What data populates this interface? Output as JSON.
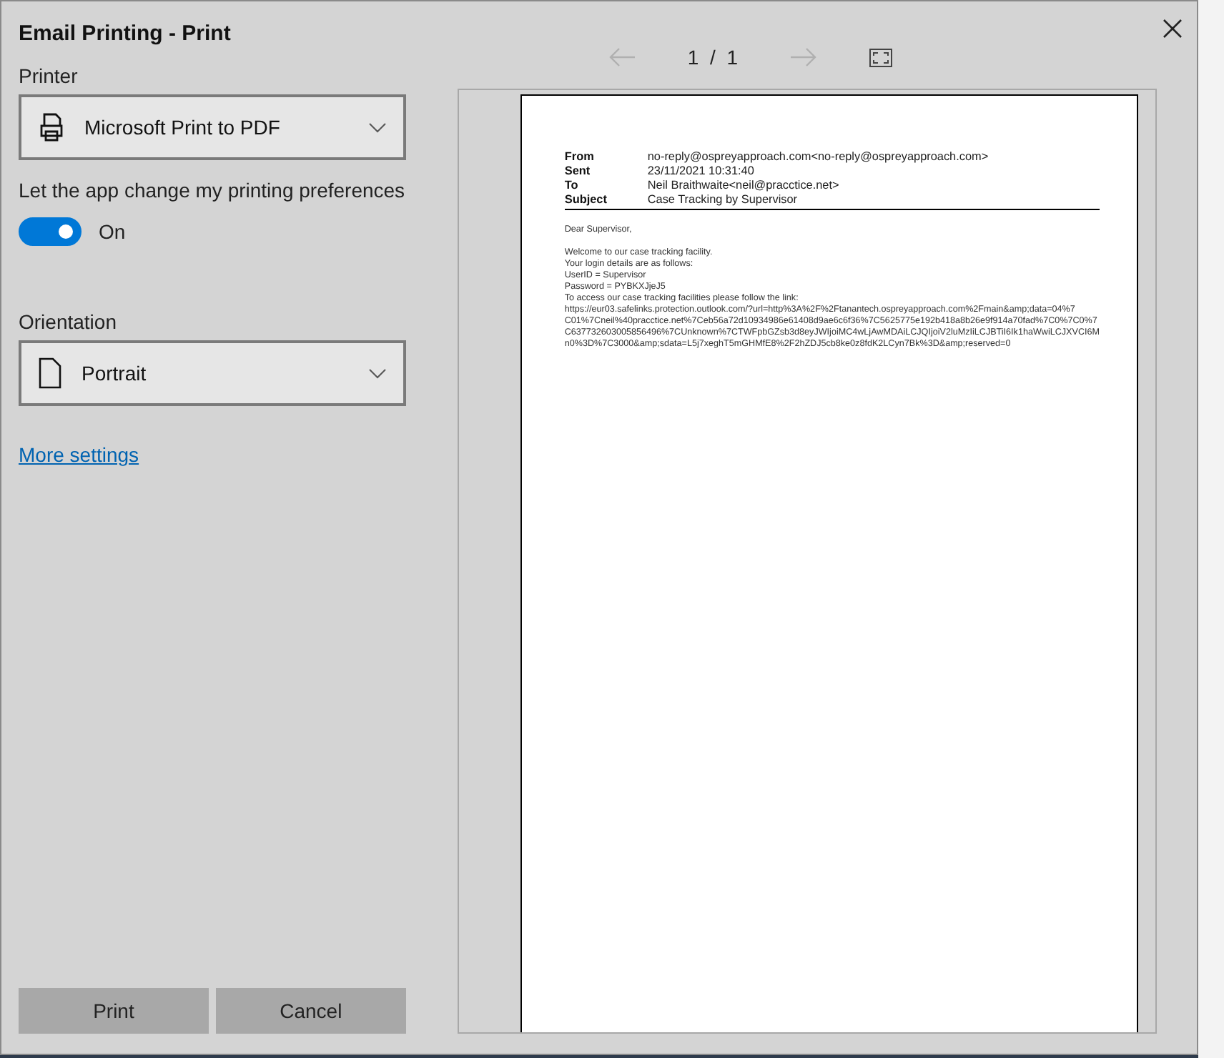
{
  "window": {
    "title": "Email Printing - Print"
  },
  "printer": {
    "label": "Printer",
    "value": "Microsoft Print to PDF"
  },
  "preferences": {
    "label": "Let the app change my printing preferences",
    "on": true,
    "state_text": "On"
  },
  "orientation": {
    "label": "Orientation",
    "value": "Portrait"
  },
  "more_settings": "More settings",
  "pager": {
    "previous_disabled": true,
    "next_disabled": true,
    "page": "1 / 1"
  },
  "preview": {
    "headers": [
      {
        "name": "From",
        "value": "no-reply@ospreyapproach.com<no-reply@ospreyapproach.com>"
      },
      {
        "name": "Sent",
        "value": "23/11/2021 10:31:40"
      },
      {
        "name": "To",
        "value": "Neil Braithwaite<neil@pracctice.net>"
      },
      {
        "name": "Subject",
        "value": "Case Tracking by Supervisor"
      }
    ],
    "greeting": "Dear  Supervisor,",
    "body_lines": [
      "Welcome to our case tracking facility.",
      "Your login details are as follows:",
      "UserID =  Supervisor",
      "Password =   PYBKXJjeJ5",
      "To access our case tracking facilities please follow the link:",
      "https://eur03.safelinks.protection.outlook.com/?url=http%3A%2F%2Ftanantech.ospreyapproach.com%2Fmain&amp;data=04%7",
      "C01%7Cneil%40pracctice.net%7Ceb56a72d10934986e61408d9ae6c6f36%7C5625775e192b418a8b26e9f914a70fad%7C0%7C0%7",
      "C637732603005856496%7CUnknown%7CTWFpbGZsb3d8eyJWIjoiMC4wLjAwMDAiLCJQIjoiV2luMzIiLCJBTiI6Ik1haWwiLCJXVCI6M",
      "n0%3D%7C3000&amp;sdata=L5j7xeghT5mGHMfE8%2F2hZDJ5cb8ke0z8fdK2LCyn7Bk%3D&amp;reserved=0"
    ]
  },
  "buttons": [
    "Print",
    "Cancel"
  ]
}
